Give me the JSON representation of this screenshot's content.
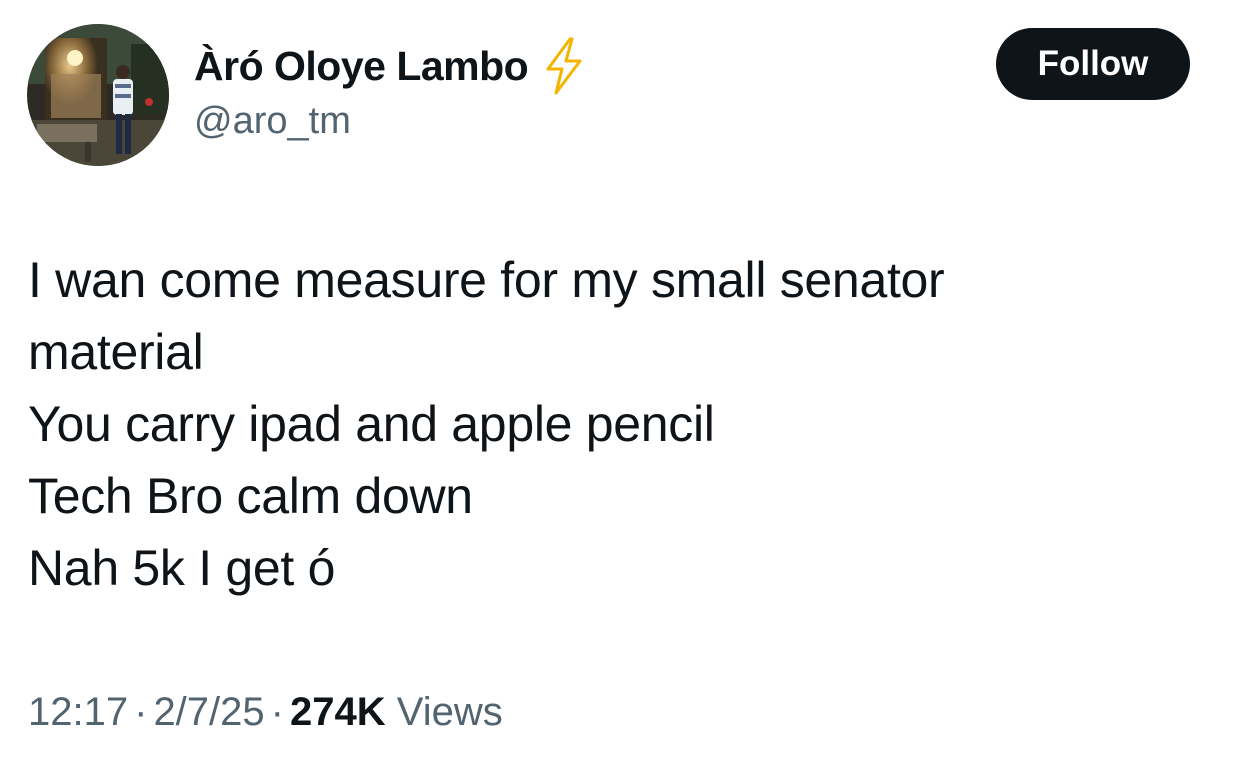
{
  "author": {
    "display_name": "Àró Oloye Lambo",
    "handle": "@aro_tm",
    "badge_icon": "lightning-bolt-icon",
    "avatar_icon": "profile-photo"
  },
  "follow_button": {
    "label": "Follow"
  },
  "tweet": {
    "text": "I wan come measure for my small senator\nmaterial\nYou carry ipad and apple pencil\nTech Bro calm down\nNah 5k I get ó"
  },
  "meta": {
    "time": "12:17",
    "separator": "·",
    "date": "2/7/25",
    "views_count": "274K",
    "views_label": "Views"
  },
  "colors": {
    "text_primary": "#0f1419",
    "text_secondary": "#536471",
    "button_bg": "#0f1419",
    "button_text": "#ffffff",
    "bolt": "#f4b400"
  }
}
